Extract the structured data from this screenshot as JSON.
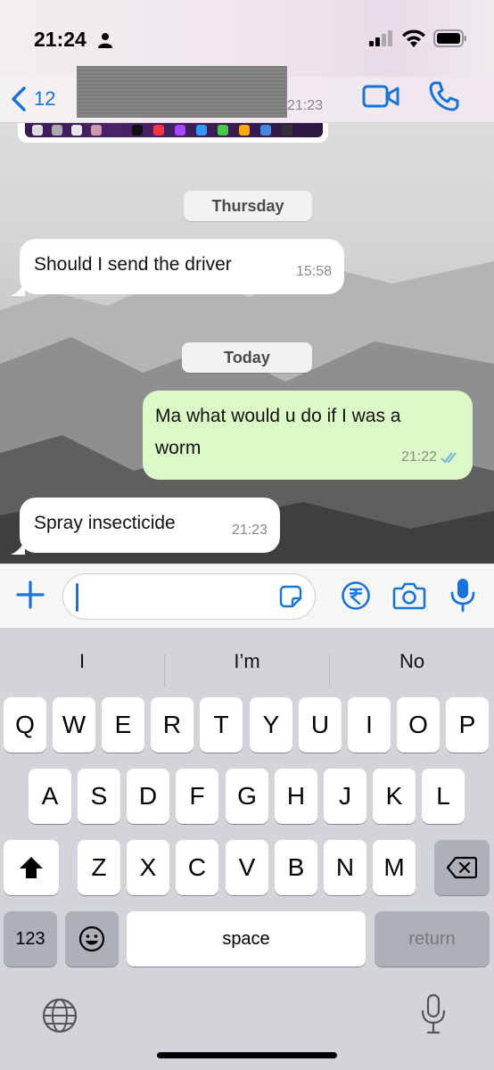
{
  "status_bar": {
    "time": "21:24"
  },
  "header": {
    "back_count": "12",
    "last_seen_time": "21:23"
  },
  "chat": {
    "date_chips": [
      "Thursday",
      "Today"
    ],
    "messages": [
      {
        "direction": "incoming",
        "text": "Should I send the driver",
        "time": "15:58"
      },
      {
        "direction": "outgoing",
        "text_line1": "Ma what would u do if I was a",
        "text_line2": "worm",
        "time": "21:22",
        "status": "read"
      },
      {
        "direction": "incoming",
        "text": "Spray insecticide",
        "time": "21:23"
      }
    ]
  },
  "input": {
    "placeholder": ""
  },
  "keyboard": {
    "suggestions": [
      "I",
      "I’m",
      "No"
    ],
    "row1": [
      "Q",
      "W",
      "E",
      "R",
      "T",
      "Y",
      "U",
      "I",
      "O",
      "P"
    ],
    "row2": [
      "A",
      "S",
      "D",
      "F",
      "G",
      "H",
      "J",
      "K",
      "L"
    ],
    "row3": [
      "Z",
      "X",
      "C",
      "V",
      "B",
      "N",
      "M"
    ],
    "numbers_label": "123",
    "space_label": "space",
    "return_label": "return"
  },
  "colors": {
    "accent": "#1a73d8",
    "outgoing_bubble": "#dcf8c6",
    "incoming_bubble": "#ffffff"
  },
  "icons": [
    "person-icon",
    "signal-icon",
    "wifi-icon",
    "battery-icon",
    "back-chevron-icon",
    "video-call-icon",
    "phone-call-icon",
    "plus-icon",
    "sticker-icon",
    "rupee-payment-icon",
    "camera-icon",
    "microphone-icon",
    "shift-icon",
    "backspace-icon",
    "emoji-icon",
    "globe-icon",
    "dictation-mic-icon",
    "double-check-icon"
  ]
}
